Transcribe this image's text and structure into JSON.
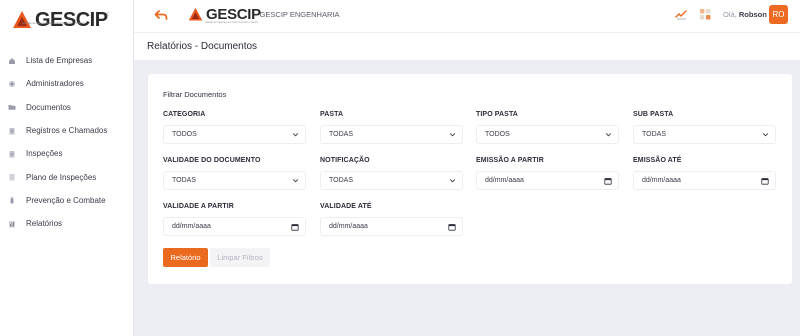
{
  "sidebar": {
    "logo_text": "GESCIP",
    "logo_subtitle": "Gestão de Segurança Contra Incêndio e Pânico",
    "items": [
      {
        "label": "Lista de Empresas"
      },
      {
        "label": "Administradores"
      },
      {
        "label": "Documentos"
      },
      {
        "label": "Registros e Chamados"
      },
      {
        "label": "Inspeções"
      },
      {
        "label": "Plano de Inspeções"
      },
      {
        "label": "Prevenção e Combate"
      },
      {
        "label": "Relatórios"
      }
    ]
  },
  "header": {
    "brand_text": "GESCIP",
    "brand_subtitle": "Gestão de Segurança Contra Incêndio e Pânico",
    "company": "- GESCIP ENGENHARIA",
    "greeting_prefix": "Olá,",
    "user_name": "Robson",
    "avatar_initials": "RO"
  },
  "page": {
    "title": "Relatórios - Documentos"
  },
  "filters": {
    "title": "Filtrar Documentos",
    "categoria": {
      "label": "CATEGORIA",
      "value": "TODOS"
    },
    "pasta": {
      "label": "PASTA",
      "value": "TODAS"
    },
    "tipo_pasta": {
      "label": "TIPO PASTA",
      "value": "TODOS"
    },
    "sub_pasta": {
      "label": "SUB PASTA",
      "value": "TODAS"
    },
    "validade_documento": {
      "label": "VALIDADE DO DOCUMENTO",
      "value": "TODAS"
    },
    "notificacao": {
      "label": "NOTIFICAÇÃO",
      "value": "TODAS"
    },
    "emissao_partir": {
      "label": "EMISSÃO A PARTIR",
      "value": "dd/mm/aaaa"
    },
    "emissao_ate": {
      "label": "EMISSÃO ATÉ",
      "value": "dd/mm/aaaa"
    },
    "validade_partir": {
      "label": "VALIDADE A PARTIR",
      "value": "dd/mm/aaaa"
    },
    "validade_ate": {
      "label": "VALIDADE ATÉ",
      "value": "dd/mm/aaaa"
    }
  },
  "actions": {
    "report_label": "Relatório",
    "clear_label": "Limpar Filtros"
  },
  "colors": {
    "accent": "#ea6a20",
    "background": "#edeef4"
  }
}
